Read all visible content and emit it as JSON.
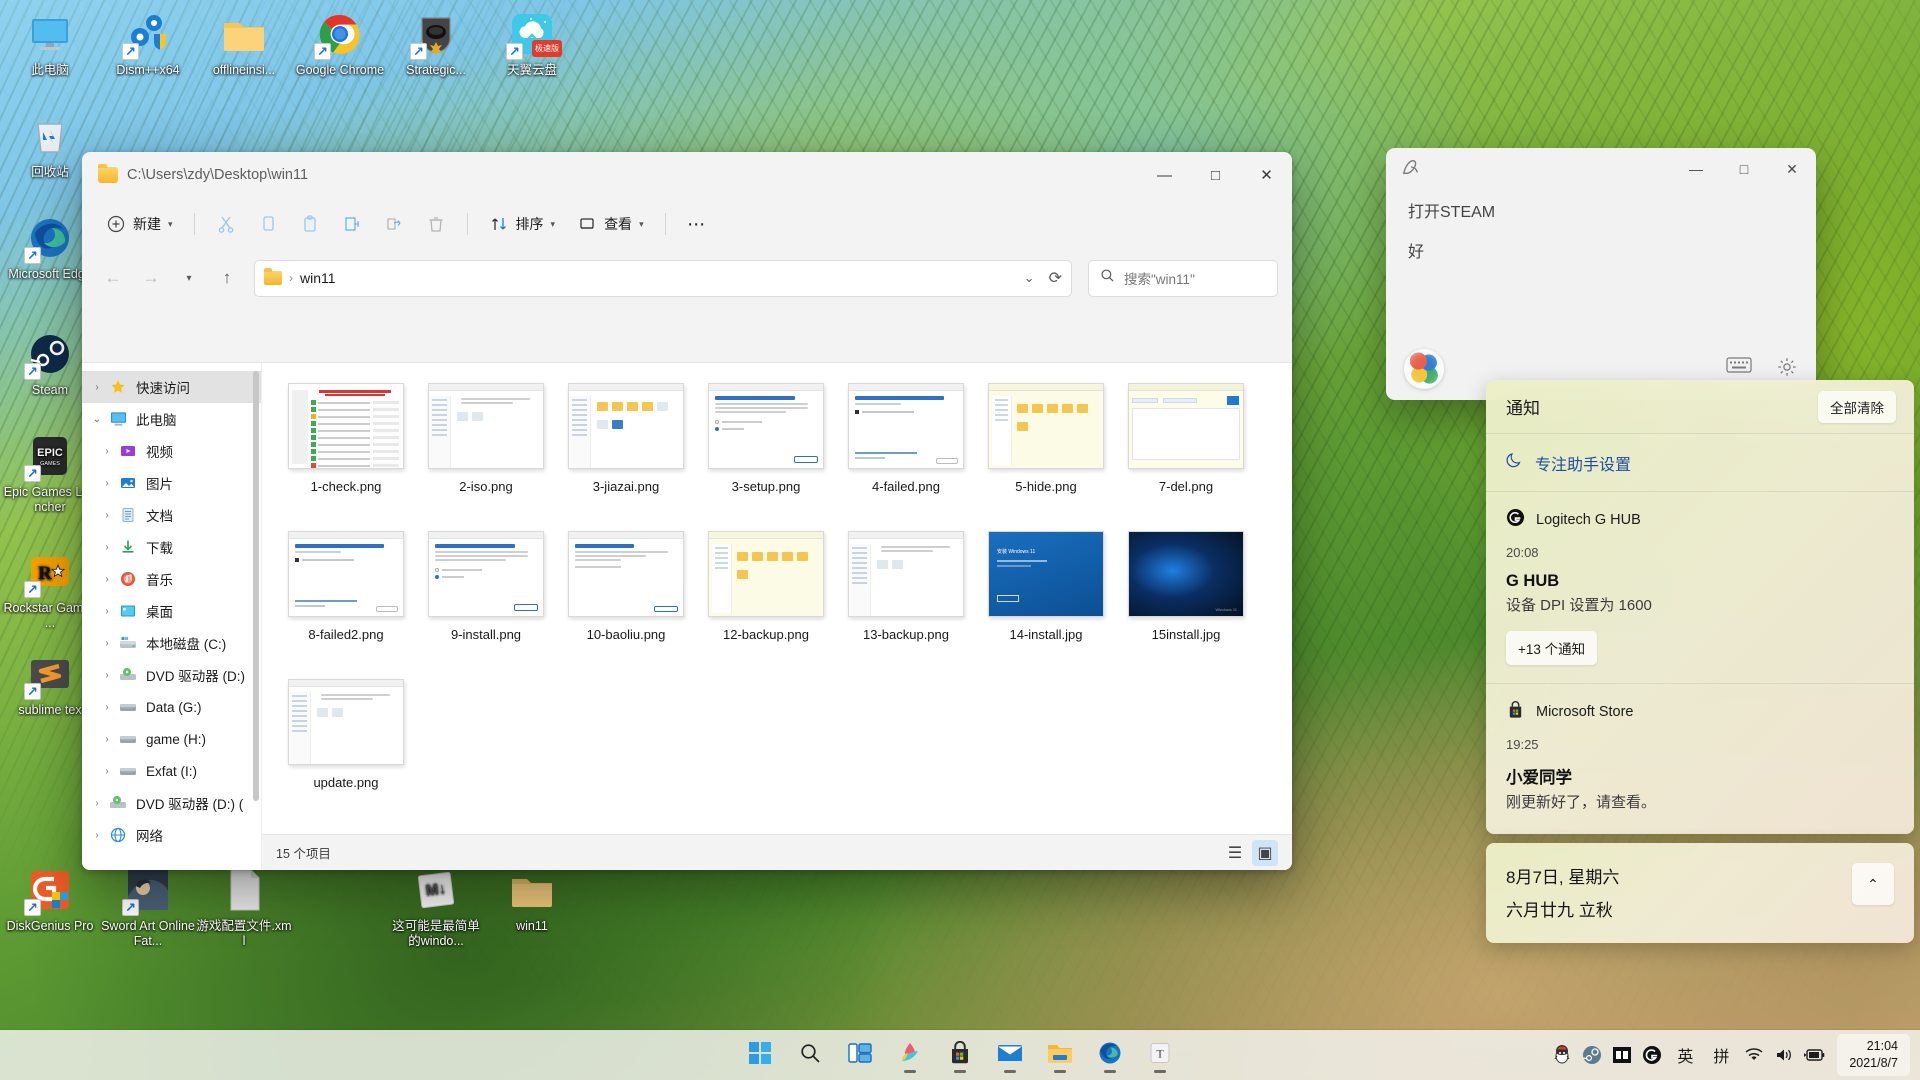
{
  "desktop": {
    "icons_col1": [
      {
        "label": "此电脑",
        "icon": "this-pc-icon",
        "shortcut": false
      },
      {
        "label": "回收站",
        "icon": "recycle-bin-icon",
        "shortcut": false
      },
      {
        "label": "Microsoft Edge",
        "icon": "edge-icon",
        "shortcut": true
      },
      {
        "label": "Steam",
        "icon": "steam-icon",
        "shortcut": true
      },
      {
        "label": "Epic Games Launcher",
        "icon": "epic-games-icon",
        "shortcut": true
      },
      {
        "label": "Rockstar Games ...",
        "icon": "rockstar-games-icon",
        "shortcut": true
      },
      {
        "label": "sublime tex",
        "icon": "sublime-text-icon",
        "shortcut": true
      },
      {
        "label": "DiskGenius Pro",
        "icon": "diskgenius-icon",
        "shortcut": true
      }
    ],
    "icons_row1": [
      {
        "label": "Dism++x64",
        "icon": "dism-icon",
        "shortcut": true
      },
      {
        "label": "offlineinsi...",
        "icon": "folder-icon",
        "shortcut": false
      },
      {
        "label": "Google Chrome",
        "icon": "chrome-icon",
        "shortcut": true
      },
      {
        "label": "Strategic...",
        "icon": "strategic-game-icon",
        "shortcut": true
      },
      {
        "label": "天翼云盘",
        "icon": "tianyi-cloud-icon",
        "shortcut": true
      }
    ],
    "icons_bottom": [
      {
        "label": "Sword Art Online Fat...",
        "icon": "sword-art-online-icon",
        "shortcut": true
      },
      {
        "label": "游戏配置文件.xml",
        "icon": "xml-file-icon",
        "shortcut": false
      },
      {
        "label": "这可能是最简单的windo...",
        "icon": "markdown-file-icon",
        "shortcut": false
      },
      {
        "label": "win11",
        "icon": "folder-icon",
        "shortcut": false
      }
    ]
  },
  "explorer": {
    "title": "C:\\Users\\zdy\\Desktop\\win11",
    "window_controls": {
      "minimize": "—",
      "maximize": "□",
      "close": "✕"
    },
    "toolbar": {
      "new_label": "新建",
      "cut_label": "剪切",
      "copy_label": "复制",
      "paste_label": "粘贴",
      "rename_label": "重命名",
      "share_label": "共享",
      "delete_label": "删除",
      "sort_label": "排序",
      "view_label": "查看",
      "more_label": "查看更多"
    },
    "address": {
      "crumb": "win11",
      "separator": "›",
      "dropdown": "⌄",
      "refresh": "⟳"
    },
    "search": {
      "placeholder": "搜索\"win11\""
    },
    "sidebar": [
      {
        "label": "快速访问",
        "level": 1,
        "expanded": false,
        "selected": true,
        "icon": "star-icon"
      },
      {
        "label": "此电脑",
        "level": 1,
        "expanded": true,
        "selected": false,
        "icon": "this-pc-icon"
      },
      {
        "label": "视频",
        "level": 2,
        "expanded": false,
        "selected": false,
        "icon": "videos-icon"
      },
      {
        "label": "图片",
        "level": 2,
        "expanded": false,
        "selected": false,
        "icon": "pictures-icon"
      },
      {
        "label": "文档",
        "level": 2,
        "expanded": false,
        "selected": false,
        "icon": "documents-icon"
      },
      {
        "label": "下载",
        "level": 2,
        "expanded": false,
        "selected": false,
        "icon": "downloads-icon"
      },
      {
        "label": "音乐",
        "level": 2,
        "expanded": false,
        "selected": false,
        "icon": "music-icon"
      },
      {
        "label": "桌面",
        "level": 2,
        "expanded": false,
        "selected": false,
        "icon": "desktop-icon"
      },
      {
        "label": "本地磁盘 (C:)",
        "level": 2,
        "expanded": false,
        "selected": false,
        "icon": "system-drive-icon"
      },
      {
        "label": "DVD 驱动器 (D:)",
        "level": 2,
        "expanded": false,
        "selected": false,
        "icon": "dvd-drive-icon"
      },
      {
        "label": "Data (G:)",
        "level": 2,
        "expanded": false,
        "selected": false,
        "icon": "drive-icon"
      },
      {
        "label": "game (H:)",
        "level": 2,
        "expanded": false,
        "selected": false,
        "icon": "drive-icon"
      },
      {
        "label": "Exfat (I:)",
        "level": 2,
        "expanded": false,
        "selected": false,
        "icon": "drive-icon"
      },
      {
        "label": "DVD 驱动器 (D:) (",
        "level": 1,
        "expanded": false,
        "selected": false,
        "icon": "dvd-drive-icon"
      },
      {
        "label": "网络",
        "level": 1,
        "expanded": false,
        "selected": false,
        "icon": "network-icon"
      }
    ],
    "files": [
      {
        "name": "1-check.png",
        "thumb": "check-report"
      },
      {
        "name": "2-iso.png",
        "thumb": "explorer-win"
      },
      {
        "name": "3-jiazai.png",
        "thumb": "explorer-folders"
      },
      {
        "name": "3-setup.png",
        "thumb": "setup-dialog"
      },
      {
        "name": "4-failed.png",
        "thumb": "failed-dialog"
      },
      {
        "name": "5-hide.png",
        "thumb": "explorer-yellow"
      },
      {
        "name": "7-del.png",
        "thumb": "explorer-blue"
      },
      {
        "name": "8-failed2.png",
        "thumb": "failed-dialog"
      },
      {
        "name": "9-install.png",
        "thumb": "setup-dialog"
      },
      {
        "name": "10-baoliu.png",
        "thumb": "ready-dialog"
      },
      {
        "name": "12-backup.png",
        "thumb": "explorer-yellow"
      },
      {
        "name": "13-backup.png",
        "thumb": "explorer-win"
      },
      {
        "name": "14-install.jpg",
        "thumb": "blue-install"
      },
      {
        "name": "15install.jpg",
        "thumb": "dark-install"
      },
      {
        "name": "update.png",
        "thumb": "explorer-win"
      }
    ],
    "status": {
      "item_count": "15 个项目"
    },
    "view_toggles": {
      "list": "☰",
      "tiles": "▣"
    }
  },
  "assistant": {
    "app_icon": "xiaoai-logo-icon",
    "window_controls": {
      "minimize": "—",
      "maximize": "□",
      "close": "✕"
    },
    "messages": [
      "打开STEAM",
      "好"
    ],
    "footer": {
      "keyboard": "⌨",
      "settings": "⚙"
    }
  },
  "notifications": {
    "header": {
      "title": "通知",
      "clear_all": "全部清除"
    },
    "focus_assist": {
      "label": "专注助手设置",
      "icon": "moon-icon"
    },
    "items": [
      {
        "app": "Logitech G HUB",
        "app_icon": "logitech-g-icon",
        "time": "20:08",
        "title": "G HUB",
        "body": "设备 DPI 设置为 1600",
        "more": "+13 个通知"
      },
      {
        "app": "Microsoft Store",
        "app_icon": "microsoft-store-icon",
        "time": "19:25",
        "title": "小爱同学",
        "body": "刚更新好了，请查看。",
        "more": null
      }
    ],
    "date_card": {
      "line1": "8月7日, 星期六",
      "line2": "六月廿九 立秋",
      "collapse": "⌃"
    }
  },
  "taskbar": {
    "apps": [
      {
        "name": "start-button",
        "icon": "windows-logo-icon",
        "active": false
      },
      {
        "name": "search-button",
        "icon": "search-icon",
        "active": false
      },
      {
        "name": "task-view-button",
        "icon": "task-view-icon",
        "active": false
      },
      {
        "name": "widgets-button",
        "icon": "widgets-icon",
        "active": true
      },
      {
        "name": "microsoft-store-button",
        "icon": "microsoft-store-icon",
        "active": true
      },
      {
        "name": "mail-button",
        "icon": "mail-icon",
        "active": true
      },
      {
        "name": "file-explorer-button",
        "icon": "file-explorer-icon",
        "active": true
      },
      {
        "name": "edge-button",
        "icon": "edge-icon",
        "active": true
      },
      {
        "name": "translate-button",
        "icon": "translate-icon",
        "active": true
      }
    ],
    "tray": [
      {
        "name": "qq-tray-icon",
        "icon": "qq-icon"
      },
      {
        "name": "steam-tray-icon",
        "icon": "steam-icon"
      },
      {
        "name": "display-tray-icon",
        "icon": "display-icon"
      },
      {
        "name": "logitech-ghub-tray-icon",
        "icon": "logitech-g-icon"
      }
    ],
    "ime": {
      "language": "英",
      "mode": "拼"
    },
    "system": {
      "network": "wifi-icon",
      "volume": "volume-icon",
      "battery": "battery-charging-icon"
    },
    "clock": {
      "time": "21:04",
      "date": "2021/8/7"
    }
  }
}
